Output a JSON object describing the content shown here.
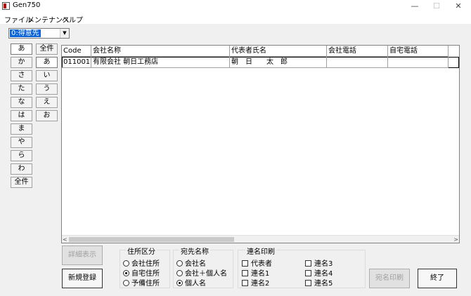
{
  "window": {
    "title": "Gen750",
    "min_glyph": "—",
    "max_glyph": "☐",
    "close_glyph": "✕"
  },
  "menu": {
    "items": [
      "ファイル",
      "メンテナンス",
      "ヘルプ"
    ]
  },
  "customer_type": {
    "value": "0:得意先",
    "arrow": "▼"
  },
  "kana_column1": [
    "あ",
    "か",
    "さ",
    "た",
    "な",
    "は",
    "ま",
    "や",
    "ら",
    "わ",
    "全件"
  ],
  "kana_column2": [
    "全件",
    "あ",
    "い",
    "う",
    "え",
    "お"
  ],
  "grid": {
    "headers": [
      "Code",
      "会社名称",
      "代表者氏名",
      "会社電話",
      "自宅電話"
    ],
    "rows": [
      {
        "code": "011001",
        "company": "有限会社 朝日工務店",
        "representative": "朝　日　　太　郎",
        "company_phone": "",
        "home_phone": ""
      }
    ],
    "scroll_left": "<",
    "scroll_right": ">"
  },
  "buttons": {
    "details": "詳細表示",
    "new": "新規登録",
    "print_label": "宛名印刷",
    "exit": "終了"
  },
  "address_type": {
    "title": "住所区分",
    "options": [
      "会社住所",
      "自宅住所",
      "予備住所"
    ],
    "selected": 1
  },
  "addressee_name": {
    "title": "宛先名称",
    "options": [
      "会社名",
      "会社＋個人名",
      "個人名"
    ],
    "selected": 2
  },
  "joint_print": {
    "title": "連名印刷",
    "col1": [
      "代表者",
      "連名1",
      "連名2"
    ],
    "col2": [
      "連名3",
      "連名4",
      "連名5"
    ]
  }
}
